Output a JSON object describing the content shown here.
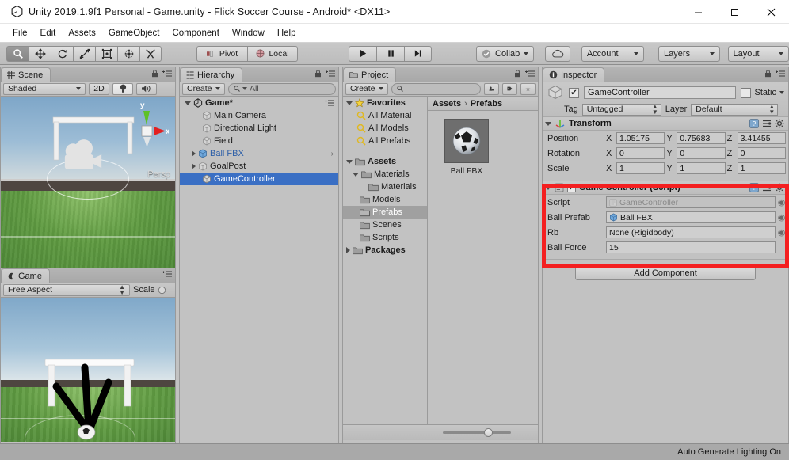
{
  "window": {
    "title": "Unity 2019.1.9f1 Personal - Game.unity - Flick Soccer Course - Android* <DX11>",
    "logo_icon": "unity-logo-icon",
    "minimize_label": "—",
    "maximize_label": "□",
    "close_label": "✕"
  },
  "menubar": {
    "items": [
      {
        "label": "File"
      },
      {
        "label": "Edit"
      },
      {
        "label": "Assets"
      },
      {
        "label": "GameObject"
      },
      {
        "label": "Component"
      },
      {
        "label": "Window"
      },
      {
        "label": "Help"
      }
    ]
  },
  "toolbar": {
    "tools": [
      {
        "name": "hand-tool",
        "icon": "magnifier-icon",
        "active": true
      },
      {
        "name": "move-tool",
        "icon": "move-arrows-icon",
        "active": false
      },
      {
        "name": "rotate-tool",
        "icon": "rotate-icon",
        "active": false
      },
      {
        "name": "scale-tool",
        "icon": "scale-icon",
        "active": false
      },
      {
        "name": "rect-tool",
        "icon": "rect-transform-icon",
        "active": false
      },
      {
        "name": "transform-tool",
        "icon": "combined-transform-icon",
        "active": false
      },
      {
        "name": "custom-tool",
        "icon": "custom-editor-tool-icon",
        "active": false
      }
    ],
    "pivot_label": "Pivot",
    "local_label": "Local",
    "play_label": "▶",
    "pause_label": "❙❙",
    "step_label": "▶❙",
    "collab_label": "Collab",
    "cloud_icon": "cloud-icon",
    "account_label": "Account",
    "layers_label": "Layers",
    "layout_label": "Layout"
  },
  "scene": {
    "tab_label": "Scene",
    "tab_icon": "scene-grid-icon",
    "shading_mode": "Shaded",
    "mode_2d_label": "2D",
    "lighting_icon": "lightbulb-icon",
    "audio_icon": "speaker-icon",
    "persp_label": "Persp",
    "axis_y_label": "y",
    "axis_x_label": "x"
  },
  "game": {
    "tab_label": "Game",
    "tab_icon": "game-pad-icon",
    "aspect_label": "Free Aspect",
    "scale_label": "Scale"
  },
  "hierarchy": {
    "tab_label": "Hierarchy",
    "tab_icon": "hierarchy-icon",
    "create_label": "Create",
    "search_placeholder": "All",
    "search_value": "",
    "items": [
      {
        "label": "Game*",
        "depth": 0,
        "expanded": true,
        "icon": "unity-scene-icon",
        "selected": false,
        "style": "root"
      },
      {
        "label": "Main Camera",
        "depth": 1,
        "expanded": null,
        "icon": "gameobject-cube-icon",
        "selected": false,
        "style": ""
      },
      {
        "label": "Directional Light",
        "depth": 1,
        "expanded": null,
        "icon": "gameobject-cube-icon",
        "selected": false,
        "style": ""
      },
      {
        "label": "Field",
        "depth": 1,
        "expanded": null,
        "icon": "gameobject-cube-icon",
        "selected": false,
        "style": ""
      },
      {
        "label": "Ball FBX",
        "depth": 1,
        "expanded": false,
        "icon": "prefab-cube-icon",
        "selected": false,
        "style": "blue"
      },
      {
        "label": "GoalPost",
        "depth": 1,
        "expanded": false,
        "icon": "gameobject-cube-icon",
        "selected": false,
        "style": ""
      },
      {
        "label": "GameController",
        "depth": 1,
        "expanded": null,
        "icon": "gameobject-cube-icon",
        "selected": true,
        "style": ""
      }
    ]
  },
  "project": {
    "tab_label": "Project",
    "tab_icon": "folder-icon",
    "create_label": "Create",
    "search_placeholder": "",
    "search_value": "",
    "filter_icons": [
      "search-by-type-icon",
      "search-by-label-icon",
      "favorites-star-icon"
    ],
    "tree": [
      {
        "label": "Favorites",
        "depth": 0,
        "expanded": true,
        "icon": "star-icon",
        "bold": true,
        "selected": false
      },
      {
        "label": "All Material",
        "depth": 1,
        "expanded": null,
        "icon": "search-icon",
        "bold": false,
        "selected": false
      },
      {
        "label": "All Models",
        "depth": 1,
        "expanded": null,
        "icon": "search-icon",
        "bold": false,
        "selected": false
      },
      {
        "label": "All Prefabs",
        "depth": 1,
        "expanded": null,
        "icon": "search-icon",
        "bold": false,
        "selected": false
      },
      {
        "label": "Assets",
        "depth": 0,
        "expanded": true,
        "icon": "folder-icon",
        "bold": true,
        "selected": false
      },
      {
        "label": "Materials",
        "depth": 1,
        "expanded": true,
        "icon": "folder-icon",
        "bold": false,
        "selected": false
      },
      {
        "label": "Materials",
        "depth": 2,
        "expanded": null,
        "icon": "folder-icon",
        "bold": false,
        "selected": false
      },
      {
        "label": "Models",
        "depth": 1,
        "expanded": null,
        "icon": "folder-icon",
        "bold": false,
        "selected": false
      },
      {
        "label": "Prefabs",
        "depth": 1,
        "expanded": null,
        "icon": "folder-icon",
        "bold": false,
        "selected": true
      },
      {
        "label": "Scenes",
        "depth": 1,
        "expanded": null,
        "icon": "folder-icon",
        "bold": false,
        "selected": false
      },
      {
        "label": "Scripts",
        "depth": 1,
        "expanded": null,
        "icon": "folder-icon",
        "bold": false,
        "selected": false
      },
      {
        "label": "Packages",
        "depth": 0,
        "expanded": false,
        "icon": "folder-icon",
        "bold": true,
        "selected": false
      }
    ],
    "breadcrumb": [
      "Assets",
      "Prefabs"
    ],
    "breadcrumb_separator": "›",
    "assets": [
      {
        "label": "Ball FBX",
        "icon": "soccer-ball-thumbnail"
      }
    ],
    "zoom_slider_value": 60
  },
  "inspector": {
    "tab_label": "Inspector",
    "tab_icon": "info-icon",
    "object_enabled": true,
    "object_check": "✔",
    "object_name": "GameController",
    "static_label": "Static",
    "static_checked": false,
    "tag_label": "Tag",
    "tag_value": "Untagged",
    "layer_label": "Layer",
    "layer_value": "Default",
    "components": [
      {
        "name": "Transform",
        "icon": "transform-icon",
        "enabled_toggle": false,
        "rows": [
          {
            "label": "Position",
            "fields": [
              {
                "axis": "X",
                "value": "1.05175"
              },
              {
                "axis": "Y",
                "value": "0.75683"
              },
              {
                "axis": "Z",
                "value": "3.41455"
              }
            ]
          },
          {
            "label": "Rotation",
            "fields": [
              {
                "axis": "X",
                "value": "0"
              },
              {
                "axis": "Y",
                "value": "0"
              },
              {
                "axis": "Z",
                "value": "0"
              }
            ]
          },
          {
            "label": "Scale",
            "fields": [
              {
                "axis": "X",
                "value": "1"
              },
              {
                "axis": "Y",
                "value": "1"
              },
              {
                "axis": "Z",
                "value": "1"
              }
            ]
          }
        ]
      },
      {
        "name": "Game Controller (Script)",
        "icon": "script-icon",
        "enabled_toggle": true,
        "props": [
          {
            "label": "Script",
            "value": "GameController",
            "type": "object",
            "dim": true,
            "dot_color": "#b7b7b7"
          },
          {
            "label": "Ball Prefab",
            "value": "Ball FBX",
            "type": "object",
            "dim": false,
            "dot_color": "#6aa9e0"
          },
          {
            "label": "Rb",
            "value": "None (Rigidbody)",
            "type": "object",
            "dim": false,
            "dot_color": ""
          },
          {
            "label": "Ball Force",
            "value": "15",
            "type": "number",
            "dim": false,
            "dot_color": ""
          }
        ]
      }
    ],
    "add_component_label": "Add Component"
  },
  "statusbar": {
    "text": "Auto Generate Lighting On"
  },
  "colors": {
    "selection_blue": "#3a6fc4",
    "highlight_red": "#f41f20",
    "panel_bg": "#c2c2c2",
    "prefab_blue": "#2d5fa8"
  }
}
